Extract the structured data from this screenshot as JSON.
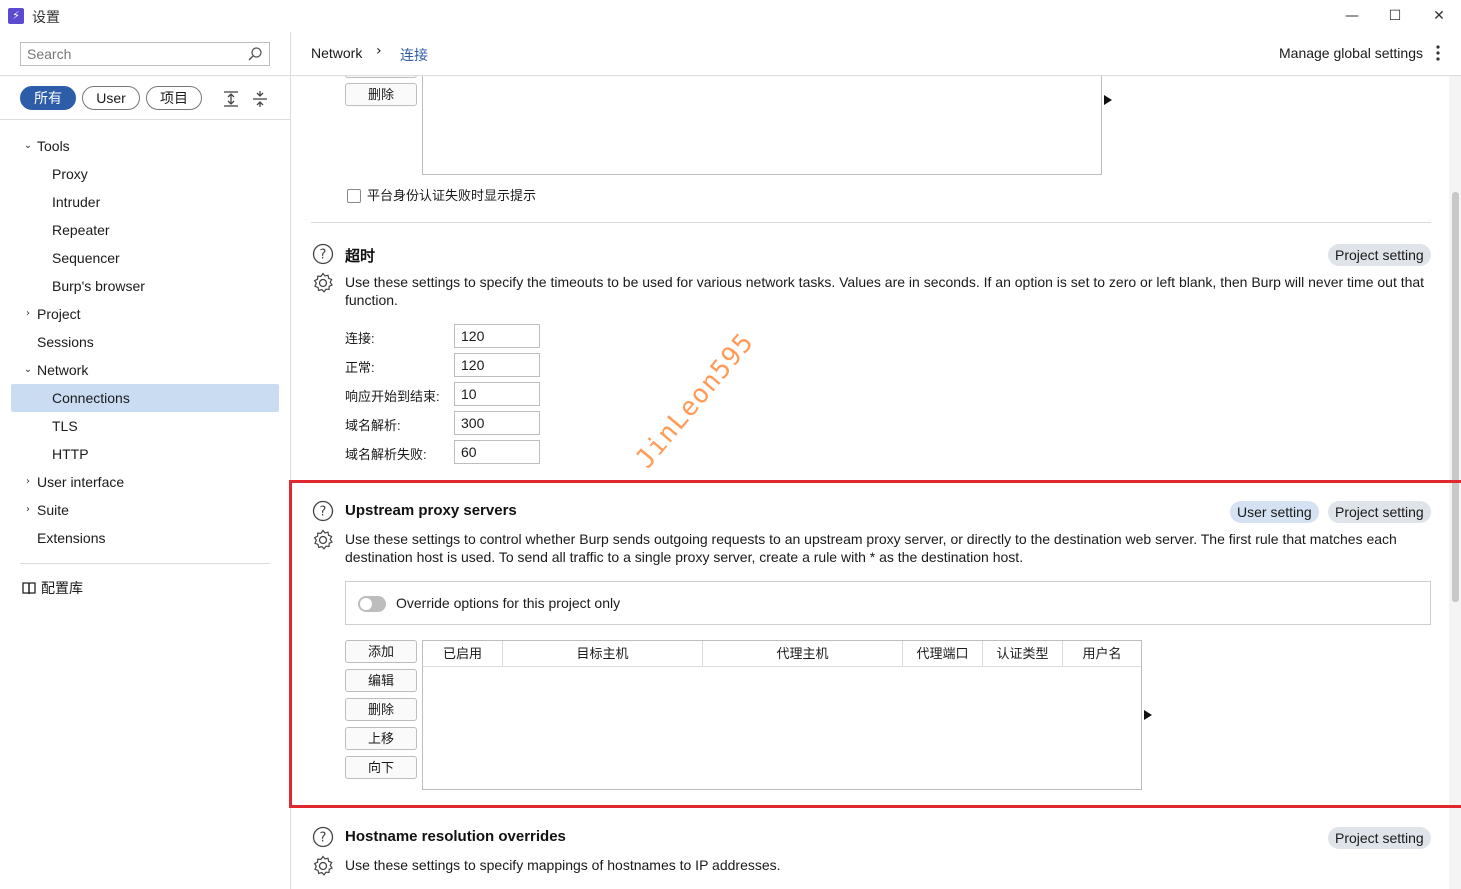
{
  "window": {
    "title": "设置",
    "app_icon": "burp-lightning-icon",
    "controls": {
      "minimize": "—",
      "maximize": "☐",
      "close": "✕"
    }
  },
  "sidebar": {
    "search_placeholder": "Search",
    "filters": [
      "所有",
      "User",
      "项目"
    ],
    "active_filter": "所有",
    "tree": [
      {
        "label": "Tools",
        "expanded": true
      },
      {
        "label": "Proxy"
      },
      {
        "label": "Intruder"
      },
      {
        "label": "Repeater"
      },
      {
        "label": "Sequencer"
      },
      {
        "label": "Burp's browser"
      },
      {
        "label": "Project",
        "expanded": false
      },
      {
        "label": "Sessions"
      },
      {
        "label": "Network",
        "expanded": true
      },
      {
        "label": "Connections",
        "selected": true
      },
      {
        "label": "TLS"
      },
      {
        "label": "HTTP"
      },
      {
        "label": "User interface",
        "expanded": false
      },
      {
        "label": "Suite",
        "expanded": false
      },
      {
        "label": "Extensions"
      }
    ],
    "library": "配置库"
  },
  "header": {
    "breadcrumb": [
      "Network",
      "连接"
    ],
    "manage_global": "Manage global settings"
  },
  "platform_auth": {
    "delete_button": "删除",
    "checkbox_label": "平台身份认证失败时显示提示",
    "checked": false
  },
  "timeouts": {
    "title": "超时",
    "badge": "Project setting",
    "description": "Use these settings to specify the timeouts to be used for various network tasks. Values are in seconds. If an option is set to zero or left blank, then Burp will never time out that function.",
    "fields": [
      {
        "label": "连接:",
        "value": "120"
      },
      {
        "label": "正常:",
        "value": "120"
      },
      {
        "label": "响应开始到结束:",
        "value": "10"
      },
      {
        "label": "域名解析:",
        "value": "300"
      },
      {
        "label": "域名解析失败:",
        "value": "60"
      }
    ]
  },
  "upstream": {
    "title": "Upstream proxy servers",
    "badges": [
      "User setting",
      "Project setting"
    ],
    "description": "Use these settings to  control whether Burp sends outgoing requests to an upstream proxy server, or directly to the destination web server. The first rule that matches each destination host is used. To send all traffic to a single proxy server, create a rule with * as the destination host.",
    "override_label": "Override options for this project only",
    "override_on": false,
    "buttons": [
      "添加",
      "编辑",
      "删除",
      "上移",
      "向下"
    ],
    "columns": [
      "已启用",
      "目标主机",
      "代理主机",
      "代理端口",
      "认证类型",
      "用户名"
    ],
    "rows": []
  },
  "hostname": {
    "title": "Hostname resolution overrides",
    "badge": "Project setting",
    "description": "Use these settings to specify mappings of hostnames to IP addresses."
  },
  "watermark": "JinLeon595",
  "colors": {
    "accent": "#2d5da8",
    "highlight_frame": "#e0282f",
    "selected_row": "#c9dcf2"
  }
}
